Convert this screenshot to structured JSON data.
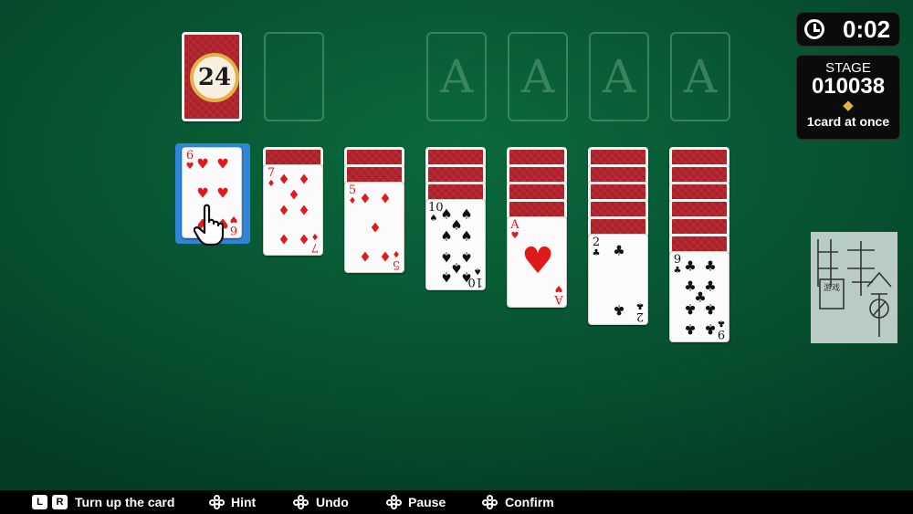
{
  "stock": {
    "count": "24"
  },
  "foundations": [
    {
      "label": "A"
    },
    {
      "label": "A"
    },
    {
      "label": "A"
    },
    {
      "label": "A"
    }
  ],
  "hud": {
    "timer": "0:02",
    "stage_label": "STAGE",
    "stage_number": "010038",
    "mode": "1card at once",
    "icons": {
      "timer": "clock-icon",
      "divider": "diamond-icon"
    }
  },
  "tableau": [
    {
      "rank": "6",
      "suit": "♥",
      "color": "red",
      "hidden": 0
    },
    {
      "rank": "7",
      "suit": "♦",
      "color": "red",
      "hidden": 1
    },
    {
      "rank": "5",
      "suit": "♦",
      "color": "red",
      "hidden": 2
    },
    {
      "rank": "10",
      "suit": "♠",
      "color": "black",
      "hidden": 3
    },
    {
      "rank": "A",
      "suit": "♥",
      "color": "red",
      "hidden": 4
    },
    {
      "rank": "2",
      "suit": "♣",
      "color": "black",
      "hidden": 5
    },
    {
      "rank": "9",
      "suit": "♣",
      "color": "black",
      "hidden": 6
    }
  ],
  "controls": {
    "key_l": "L",
    "key_r": "R",
    "turn_up": "Turn up the card",
    "hint": "Hint",
    "undo": "Undo",
    "pause": "Pause",
    "confirm": "Confirm"
  },
  "watermark": {
    "small_text": "游戏"
  },
  "colors": {
    "felt": "#075231",
    "card_back": "#b3232b",
    "selection": "#2f86d8",
    "badge_ring": "#e3b244"
  }
}
